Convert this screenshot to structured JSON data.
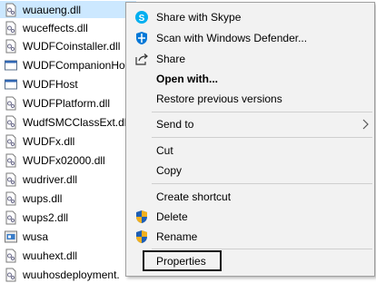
{
  "files": [
    {
      "name": "wuaueng.dll",
      "icon": "dll-icon",
      "selected": true
    },
    {
      "name": "wuceffects.dll",
      "icon": "dll-icon"
    },
    {
      "name": "WUDFCoinstaller.dll",
      "icon": "dll-icon"
    },
    {
      "name": "WUDFCompanionHo",
      "icon": "exe-window-icon"
    },
    {
      "name": "WUDFHost",
      "icon": "exe-window-icon"
    },
    {
      "name": "WUDFPlatform.dll",
      "icon": "dll-icon"
    },
    {
      "name": "WudfSMCClassExt.dll",
      "icon": "dll-icon"
    },
    {
      "name": "WUDFx.dll",
      "icon": "dll-icon"
    },
    {
      "name": "WUDFx02000.dll",
      "icon": "dll-icon"
    },
    {
      "name": "wudriver.dll",
      "icon": "dll-icon"
    },
    {
      "name": "wups.dll",
      "icon": "dll-icon"
    },
    {
      "name": "wups2.dll",
      "icon": "dll-icon"
    },
    {
      "name": "wusa",
      "icon": "wusa-app-icon"
    },
    {
      "name": "wuuhext.dll",
      "icon": "dll-icon"
    },
    {
      "name": "wuuhosdeployment.",
      "icon": "dll-icon"
    }
  ],
  "context_menu": {
    "share_with_skype": "Share with Skype",
    "scan_defender": "Scan with Windows Defender...",
    "share": "Share",
    "open_with": "Open with...",
    "restore_versions": "Restore previous versions",
    "send_to": "Send to",
    "cut": "Cut",
    "copy": "Copy",
    "create_shortcut": "Create shortcut",
    "delete": "Delete",
    "rename": "Rename",
    "properties": "Properties"
  },
  "colors": {
    "selection": "#cce8ff",
    "menu_background": "#f2f2f2",
    "skype_blue": "#00aff0",
    "defender_blue": "#0078d7"
  }
}
